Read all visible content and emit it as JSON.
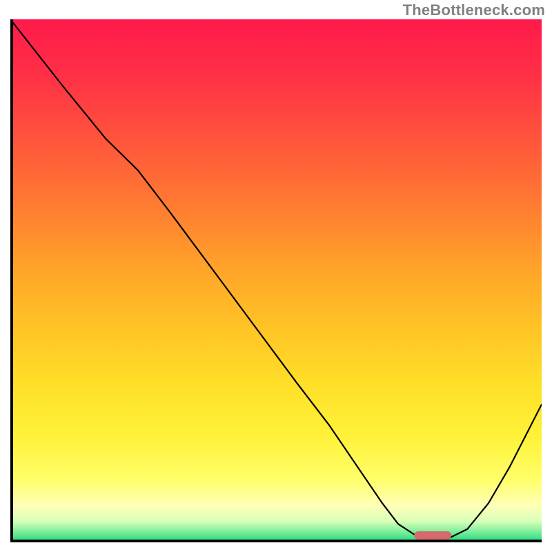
{
  "watermark": "TheBottleneck.com",
  "chart_data": {
    "type": "line",
    "title": "",
    "xlabel": "",
    "ylabel": "",
    "xlim": [
      0,
      100
    ],
    "ylim": [
      0,
      100
    ],
    "background_gradient": [
      {
        "pos": 0.0,
        "color": "#ff1a4b"
      },
      {
        "pos": 0.1,
        "color": "#ff2e46"
      },
      {
        "pos": 0.2,
        "color": "#ff4b3e"
      },
      {
        "pos": 0.3,
        "color": "#ff6a36"
      },
      {
        "pos": 0.4,
        "color": "#ff8a2e"
      },
      {
        "pos": 0.5,
        "color": "#ffab28"
      },
      {
        "pos": 0.6,
        "color": "#ffc626"
      },
      {
        "pos": 0.7,
        "color": "#ffe028"
      },
      {
        "pos": 0.8,
        "color": "#fff23a"
      },
      {
        "pos": 0.88,
        "color": "#ffff6a"
      },
      {
        "pos": 0.93,
        "color": "#ffffb8"
      },
      {
        "pos": 0.96,
        "color": "#d8ffb8"
      },
      {
        "pos": 0.98,
        "color": "#7aef9a"
      },
      {
        "pos": 1.0,
        "color": "#1fd67e"
      }
    ],
    "series": [
      {
        "name": "bottleneck-curve",
        "x": [
          0,
          10,
          18,
          24,
          30,
          38,
          46,
          54,
          60,
          66,
          70,
          73,
          76,
          79,
          82,
          86,
          90,
          94,
          100
        ],
        "values": [
          100,
          87,
          77,
          71,
          63,
          52,
          41,
          30,
          22,
          13,
          7,
          3,
          1,
          0,
          0,
          2,
          7,
          14,
          26
        ]
      }
    ],
    "marker": {
      "name": "optimal-range",
      "x_start": 76,
      "x_end": 83,
      "y": 0.8,
      "color": "#d46a6a"
    }
  }
}
